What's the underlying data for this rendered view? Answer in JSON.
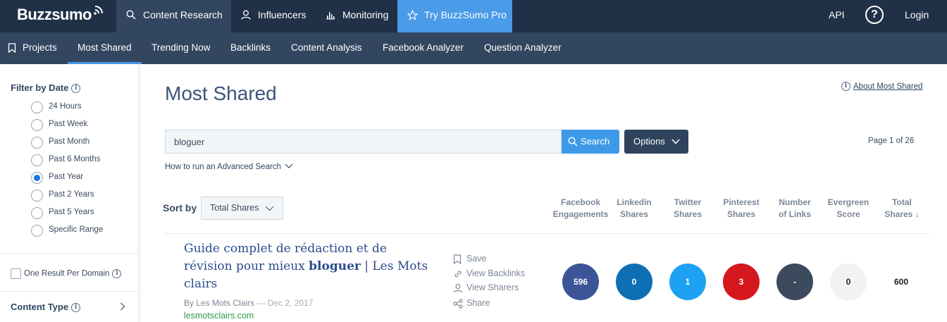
{
  "topnav": {
    "logo": "Buzzsumo",
    "items": [
      {
        "label": "Content Research",
        "icon": "search-icon"
      },
      {
        "label": "Influencers",
        "icon": "user-icon"
      },
      {
        "label": "Monitoring",
        "icon": "bar-chart-icon"
      },
      {
        "label": "Try BuzzSumo Pro",
        "icon": "star-icon"
      }
    ],
    "api": "API",
    "help": "?",
    "login": "Login",
    "colors": {
      "bar": "#203147",
      "active": "#324660",
      "pro": "#4a9be8"
    }
  },
  "subnav": {
    "projects": "Projects",
    "items": [
      "Most Shared",
      "Trending Now",
      "Backlinks",
      "Content Analysis",
      "Facebook Analyzer",
      "Question Analyzer"
    ],
    "active": "Most Shared"
  },
  "sidebar": {
    "filter_title": "Filter by Date",
    "date_options": [
      "24 Hours",
      "Past Week",
      "Past Month",
      "Past 6 Months",
      "Past Year",
      "Past 2 Years",
      "Past 5 Years",
      "Specific Range"
    ],
    "selected": "Past Year",
    "one_result": "One Result Per Domain",
    "content_type": "Content Type"
  },
  "main": {
    "title": "Most Shared",
    "about": "About Most Shared",
    "search_value": "bloguer",
    "search_button": "Search",
    "options_button": "Options",
    "page_info": "Page 1 of 26",
    "advanced": "How to run an Advanced Search",
    "sort_label": "Sort by",
    "sort_value": "Total Shares"
  },
  "columns": [
    {
      "line1": "Facebook",
      "line2": "Engagements"
    },
    {
      "line1": "Linkedin",
      "line2": "Shares"
    },
    {
      "line1": "Twitter",
      "line2": "Shares"
    },
    {
      "line1": "Pinterest",
      "line2": "Shares"
    },
    {
      "line1": "Number",
      "line2": "of Links"
    },
    {
      "line1": "Evergreen",
      "line2": "Score"
    },
    {
      "line1": "Total",
      "line2": "Shares ↓"
    }
  ],
  "result": {
    "title_before": "Guide complet de rédaction et de révision pour mieux ",
    "title_bold": "bloguer",
    "title_after": " | Les Mots clairs",
    "author": "By Les Mots Clairs",
    "date": "— Dec 2, 2017",
    "domain": "lesmotsclairs.com",
    "actions": [
      "Save",
      "View Backlinks",
      "View Sharers",
      "Share"
    ],
    "metrics": {
      "facebook": "596",
      "linkedin": "0",
      "twitter": "1",
      "pinterest": "3",
      "links": "-",
      "evergreen": "0",
      "total": "600"
    },
    "metric_colors": {
      "facebook": "#3b5598",
      "linkedin": "#0e6fb5",
      "twitter": "#1da1f2",
      "pinterest": "#d5171e",
      "links": "#3b4a5c",
      "evergreen": "#f2f2f2"
    }
  }
}
